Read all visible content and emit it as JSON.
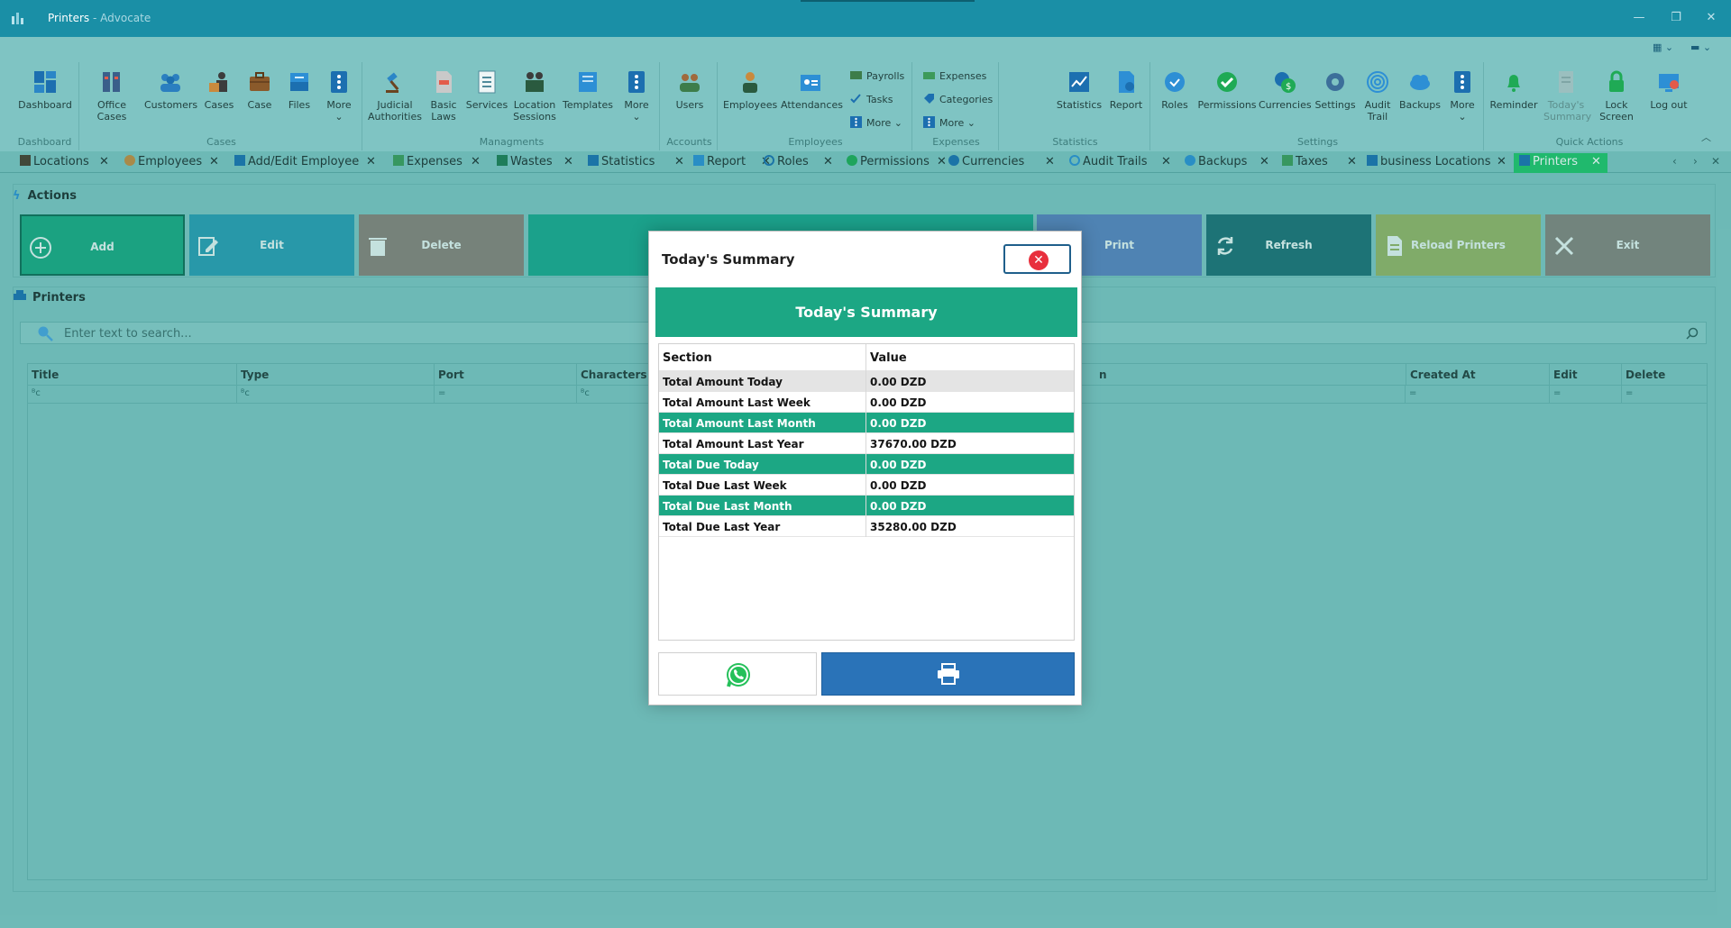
{
  "window": {
    "title": "Printers",
    "subtitle": " - Advocate",
    "minimize": "—",
    "restore": "❐",
    "close": "✕"
  },
  "ribbon": {
    "groups": {
      "dashboard": "Dashboard",
      "cases": "Cases",
      "managments": "Managments",
      "accounts": "Accounts",
      "employees": "Employees",
      "expenses": "Expenses",
      "statistics": "Statistics",
      "settings": "Settings",
      "quick_actions": "Quick Actions"
    },
    "buttons": {
      "dashboard": "Dashboard",
      "office_cases": "Office Cases",
      "customers": "Customers",
      "cases": "Cases",
      "case": "Case",
      "files": "Files",
      "more1": "More",
      "judicial_1": "Judicial",
      "judicial_2": "Authorities",
      "basic_1": "Basic",
      "basic_2": "Laws",
      "services": "Services",
      "location_1": "Location",
      "location_2": "Sessions",
      "templates": "Templates",
      "more2": "More",
      "users": "Users",
      "employees": "Employees",
      "attendances": "Attendances",
      "payrolls": "Payrolls",
      "tasks": "Tasks",
      "more_emp": "More ⌄",
      "expenses": "Expenses",
      "categories": "Categories",
      "more_exp": "More ⌄",
      "statistics": "Statistics",
      "report": "Report",
      "roles": "Roles",
      "permissions": "Permissions",
      "currencies": "Currencies",
      "settings": "Settings",
      "audit_1": "Audit",
      "audit_2": "Trail",
      "backups": "Backups",
      "more3": "More",
      "reminder": "Reminder",
      "todays_1": "Today's",
      "todays_2": "Summary",
      "lock_screen": "Lock Screen",
      "log_out": "Log out"
    },
    "more_caret": "⌄",
    "collapse": "︿",
    "view_switch_1": "▦ ⌄",
    "view_switch_2": "▬ ⌄"
  },
  "tabs": [
    "Locations",
    "Employees",
    "Add/Edit Employee",
    "Expenses",
    "Wastes",
    "Statistics",
    "Report",
    "Roles",
    "Permissions",
    "Currencies",
    "Audit Trails",
    "Backups",
    "Taxes",
    "business Locations",
    "Printers"
  ],
  "tab_close": "✕",
  "tab_nav": {
    "prev": "‹",
    "next": "›",
    "close": "✕"
  },
  "actions": {
    "title": "Actions",
    "add": "Add",
    "edit": "Edit",
    "delete": "Delete",
    "print": "Print",
    "refresh": "Refresh",
    "reload_printers": "Reload Printers",
    "exit": "Exit"
  },
  "printers": {
    "title": "Printers",
    "search_placeholder": "Enter text to search...",
    "columns": {
      "title": "Title",
      "type": "Type",
      "port": "Port",
      "characters": "Characters Pe",
      "path_tail": "n",
      "created_at": "Created At",
      "edit": "Edit",
      "delete": "Delete"
    },
    "filter_abc": "ᴮᴄ",
    "filter_eq": "="
  },
  "modal": {
    "title": "Today's Summary",
    "close_glyph": "✕",
    "banner": "Today's Summary",
    "table": {
      "headers": [
        "Section",
        "Value"
      ],
      "rows": [
        {
          "section": "Total Amount Today",
          "value": "0.00 DZD"
        },
        {
          "section": "Total Amount Last Week",
          "value": "0.00 DZD"
        },
        {
          "section": "Total Amount Last Month",
          "value": "0.00 DZD"
        },
        {
          "section": "Total Amount Last Year",
          "value": "37670.00 DZD"
        },
        {
          "section": "Total Due Today",
          "value": "0.00 DZD"
        },
        {
          "section": "Total Due Last Week",
          "value": "0.00 DZD"
        },
        {
          "section": "Total Due Last Month",
          "value": "0.00 DZD"
        },
        {
          "section": "Total Due Last Year",
          "value": "35280.00 DZD"
        }
      ]
    }
  },
  "colors": {
    "app_bg": "#7fc4c3",
    "title_bar": "#1a8fa6",
    "active_tab": "#21c46a",
    "modal_teal": "#1ca784",
    "print_blue": "#2a73b8",
    "close_red": "#e82f3d",
    "action_add": "#1ba882",
    "action_edit": "#2b9bb3",
    "action_delete": "#8a8179",
    "action_teal": "#1ca68e",
    "action_print": "#5b82bf",
    "action_refresh": "#1e6e75",
    "action_reload": "#96b364",
    "action_exit": "#86837d"
  }
}
